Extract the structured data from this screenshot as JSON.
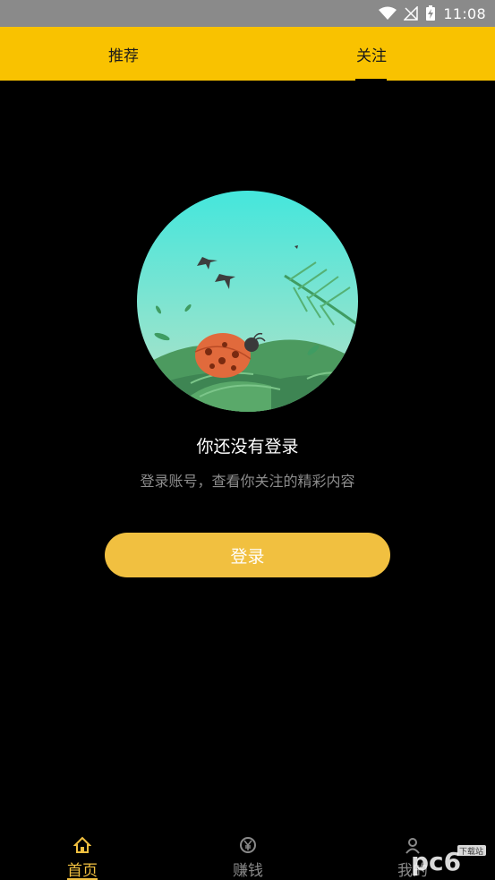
{
  "status_bar": {
    "time": "11:08",
    "icons": [
      "wifi-icon",
      "no-signal-icon",
      "battery-charging-icon"
    ]
  },
  "tabs": [
    {
      "label": "推荐",
      "active": false
    },
    {
      "label": "关注",
      "active": true
    }
  ],
  "empty_state": {
    "illustration": "ladybug-on-leaves-illustration",
    "title": "你还没有登录",
    "subtitle": "登录账号，查看你关注的精彩内容"
  },
  "login_button": {
    "label": "登录"
  },
  "bottom_nav": [
    {
      "label": "首页",
      "icon": "home-icon",
      "active": true
    },
    {
      "label": "赚钱",
      "icon": "yen-coin-icon",
      "active": false
    },
    {
      "label": "我的",
      "icon": "user-icon",
      "active": false
    }
  ],
  "watermark": {
    "text": "pc6",
    "sub": "下载站"
  },
  "colors": {
    "tab_bar": "#f9c200",
    "accent": "#f1c040",
    "background": "#000000",
    "status_bar": "#8a8a8a",
    "muted_text": "#8c8c8c"
  }
}
